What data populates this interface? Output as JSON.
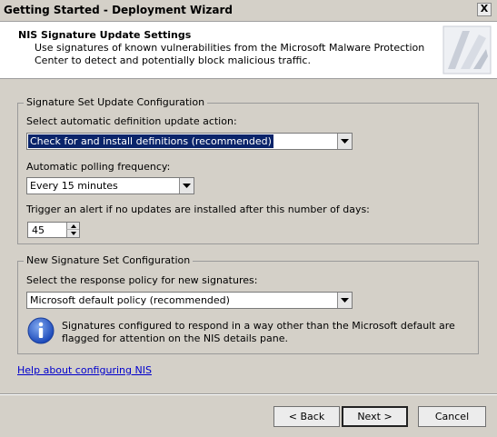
{
  "window": {
    "title": "Getting Started - Deployment Wizard",
    "close_glyph": "X"
  },
  "header": {
    "title": "NIS Signature Update Settings",
    "description": "Use signatures of known vulnerabilities from the Microsoft Malware Protection Center to detect and potentially block malicious traffic."
  },
  "update_group": {
    "legend": "Signature Set Update Configuration",
    "action_label": "Select automatic definition update action:",
    "action_value": "Check for and install definitions (recommended)",
    "polling_label": "Automatic polling frequency:",
    "polling_value": "Every 15 minutes",
    "alert_label": "Trigger an alert if no updates are installed after this number of days:",
    "alert_days": "45"
  },
  "new_group": {
    "legend": "New Signature Set Configuration",
    "policy_label": "Select the response policy for new signatures:",
    "policy_value": "Microsoft default policy (recommended)",
    "info_text": "Signatures configured to respond in a way other than the Microsoft default are flagged for attention on the NIS details pane."
  },
  "help_link": "Help about configuring NIS",
  "buttons": {
    "back": "< Back",
    "next": "Next >",
    "cancel": "Cancel"
  }
}
